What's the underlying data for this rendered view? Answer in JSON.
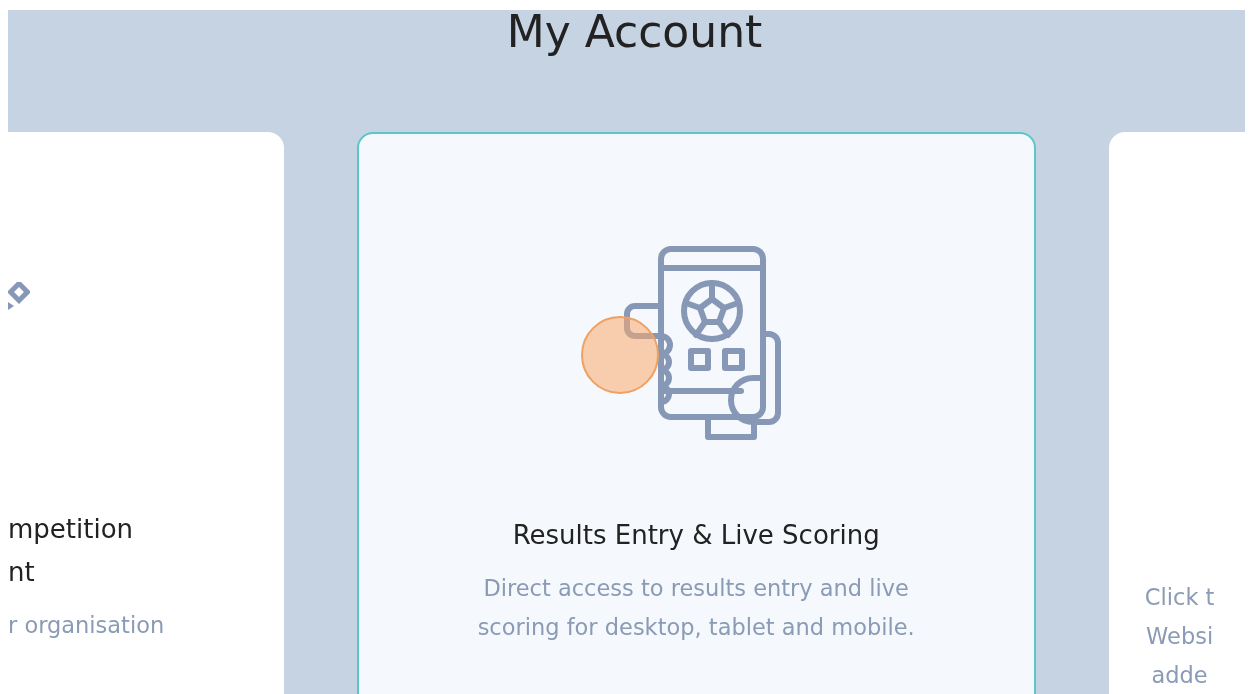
{
  "heading": "My Account",
  "cards": [
    {
      "kind": "left",
      "selected": false,
      "title_lines": [
        "mpetition",
        "nt"
      ],
      "description_lines": [
        "r organisation"
      ]
    },
    {
      "kind": "center",
      "selected": true,
      "title_lines": [
        "Results Entry & Live Scoring"
      ],
      "description_lines": [
        "Direct access to results entry and live",
        "scoring for desktop, tablet and mobile."
      ]
    },
    {
      "kind": "right",
      "selected": false,
      "description_lines": [
        "Click t",
        "Websi",
        "adde"
      ]
    }
  ],
  "click_indicator": {
    "shown": true
  }
}
